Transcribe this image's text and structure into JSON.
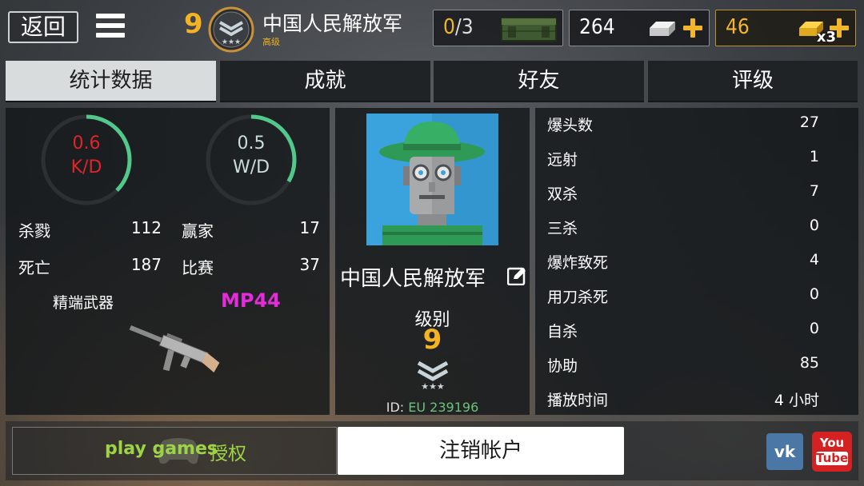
{
  "top": {
    "back_label": "返回",
    "level": "9",
    "player_name": "中国人民解放军",
    "rank_title": "高级",
    "crates": {
      "current": "0",
      "separator": "/",
      "max": "3"
    },
    "silver": "264",
    "gold": "46",
    "gold_multiplier": "x3"
  },
  "tabs": [
    {
      "label": "统计数据",
      "active": true
    },
    {
      "label": "成就",
      "active": false
    },
    {
      "label": "好友",
      "active": false
    },
    {
      "label": "评级",
      "active": false
    }
  ],
  "left_stats": {
    "kd_value": "0.6",
    "kd_label": "K/D",
    "kd_ratio_fill": 0.375,
    "wd_value": "0.5",
    "wd_label": "W/D",
    "wd_ratio_fill": 0.333,
    "kills_label": "杀戮",
    "kills": "112",
    "wins_label": "赢家",
    "wins": "17",
    "deaths_label": "死亡",
    "deaths": "187",
    "matches_label": "比赛",
    "matches": "37",
    "weapon_label": "精端武器",
    "weapon_name": "MP44"
  },
  "profile": {
    "name": "中国人民解放军",
    "level_label": "级别",
    "level": "9",
    "id_prefix": "ID:",
    "id_value": "EU 239196"
  },
  "right_stats": [
    {
      "label": "爆头数",
      "value": "27"
    },
    {
      "label": "远射",
      "value": "1"
    },
    {
      "label": "双杀",
      "value": "7"
    },
    {
      "label": "三杀",
      "value": "0"
    },
    {
      "label": "爆炸致死",
      "value": "4"
    },
    {
      "label": "用刀杀死",
      "value": "0"
    },
    {
      "label": "自杀",
      "value": "0"
    },
    {
      "label": "协助",
      "value": "85"
    },
    {
      "label": "播放时间",
      "value": "4 小时"
    }
  ],
  "bottom": {
    "play_games_text": "play games",
    "auth_label": "授权",
    "signout_label": "注销帐户",
    "vk_label": "vk",
    "youtube_label_1": "You",
    "youtube_label_2": "Tube"
  },
  "colors": {
    "gold": "#f5b323",
    "kd_red": "#e0242a",
    "ring_green": "#52c98a",
    "weapon_magenta": "#e62bdc",
    "play_green": "#9dd444"
  }
}
